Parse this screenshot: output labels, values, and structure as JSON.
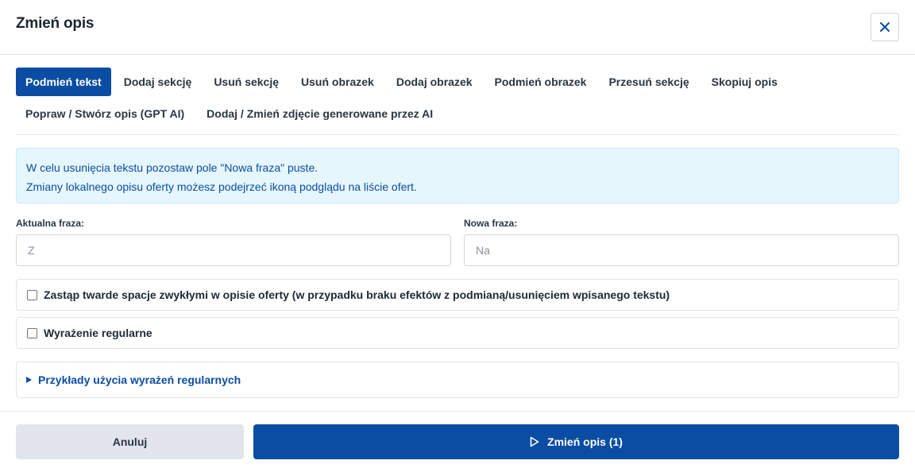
{
  "dialog": {
    "title": "Zmień opis",
    "close_icon": "close-icon"
  },
  "tabs": [
    {
      "label": "Podmień tekst",
      "active": true
    },
    {
      "label": "Dodaj sekcję"
    },
    {
      "label": "Usuń sekcję"
    },
    {
      "label": "Usuń obrazek"
    },
    {
      "label": "Dodaj obrazek"
    },
    {
      "label": "Podmień obrazek"
    },
    {
      "label": "Przesuń sekcję"
    },
    {
      "label": "Skopiuj opis"
    },
    {
      "label": "Popraw / Stwórz opis (GPT AI)"
    },
    {
      "label": "Dodaj / Zmień zdjęcie generowane przez AI"
    }
  ],
  "info": {
    "line1": "W celu usunięcia tekstu pozostaw pole \"Nowa fraza\" puste.",
    "line2": "Zmiany lokalnego opisu oferty możesz podejrzeć ikoną podglądu na liście ofert."
  },
  "fields": {
    "current": {
      "label": "Aktualna fraza:",
      "placeholder": "Z",
      "value": ""
    },
    "new": {
      "label": "Nowa fraza:",
      "placeholder": "Na",
      "value": ""
    }
  },
  "options": {
    "nbsp_label": "Zastąp twarde spacje zwykłymi w opisie oferty (w przypadku braku efektów z podmianą/usunięciem wpisanego tekstu)",
    "nbsp_checked": false,
    "regex_label": "Wyrażenie regularne",
    "regex_checked": false
  },
  "examples": {
    "label": "Przykłady użycia wyrażeń regularnych",
    "icon": "disclosure-triangle-icon"
  },
  "footer": {
    "cancel_label": "Anuluj",
    "submit_label": "Zmień opis (1)",
    "submit_icon": "play-icon"
  },
  "colors": {
    "primary": "#0b4da2",
    "info_bg": "#e6f6fd",
    "cancel_bg": "#e2e6ec"
  }
}
